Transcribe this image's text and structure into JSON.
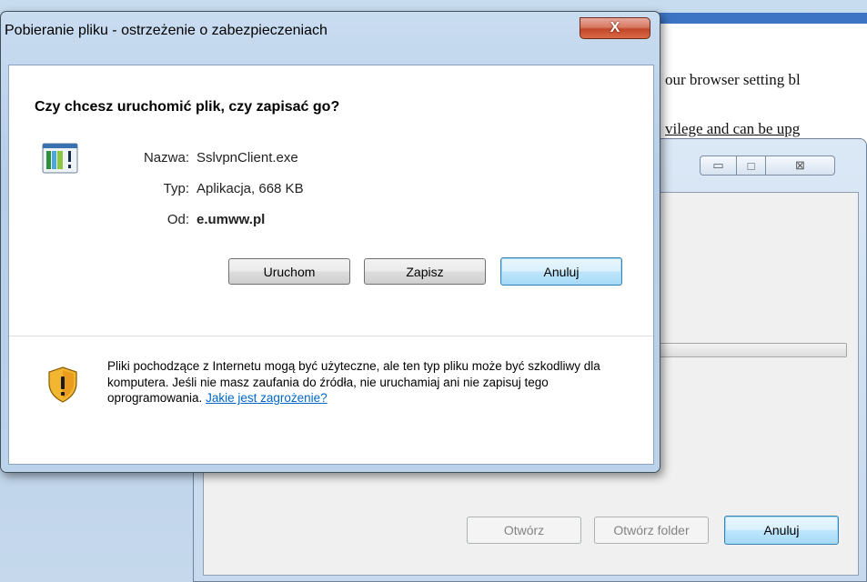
{
  "background_page": {
    "line1": "our browser setting bl",
    "line2": "vilege and can be upg"
  },
  "download_window": {
    "window_buttons": {
      "minimize": "▭",
      "maximize": "□",
      "close": "⊠"
    },
    "buttons": {
      "open": "Otwórz",
      "open_folder": "Otwórz folder",
      "cancel": "Anuluj"
    }
  },
  "dialog": {
    "title": "Pobieranie pliku - ostrzeżenie o zabezpieczeniach",
    "close_glyph": "X",
    "question": "Czy chcesz uruchomić plik, czy zapisać go?",
    "fields": {
      "name_label": "Nazwa:",
      "name_value": "SslvpnClient.exe",
      "type_label": "Typ:",
      "type_value": "Aplikacja, 668 KB",
      "from_label": "Od:",
      "from_value": "e.umww.pl"
    },
    "buttons": {
      "run": "Uruchom",
      "save": "Zapisz",
      "cancel": "Anuluj"
    },
    "warning_text": "Pliki pochodzące z Internetu mogą być użyteczne, ale ten typ pliku może być szkodliwy dla komputera. Jeśli nie masz zaufania do źródła, nie uruchamiaj ani nie zapisuj tego oprogramowania.",
    "warning_link": "Jakie jest zagrożenie?",
    "icons": {
      "file": "application-file-icon",
      "warning": "security-shield-warning-icon"
    }
  },
  "colors": {
    "link": "#0066cc",
    "aero_frame": "#b9d0e8",
    "close_button": "#c2472b",
    "default_button_border": "#3c7fb1"
  }
}
